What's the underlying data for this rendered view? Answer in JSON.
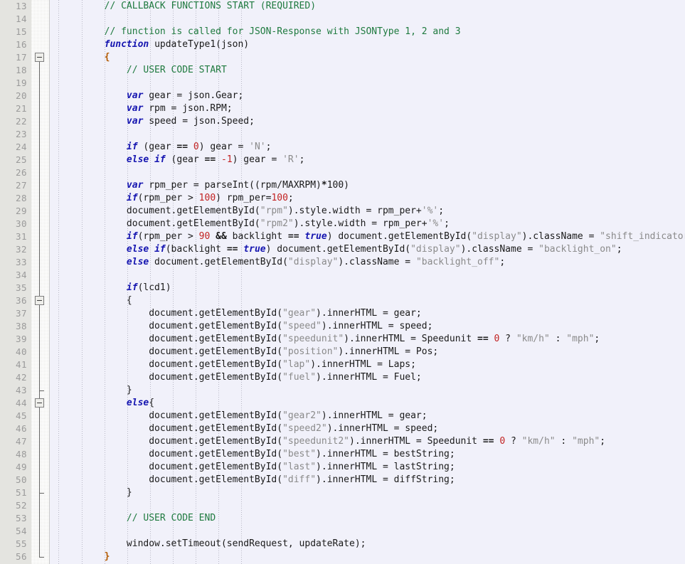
{
  "editor": {
    "kind": "code-editor",
    "language": "JavaScript",
    "theme": {
      "gutter_bg": "#e4e4e0",
      "code_bg": "#f1f1fa",
      "linenum_color": "#9a9a9a",
      "comment_color": "#1f7a3f",
      "keyword_color": "#1515b0",
      "number_color": "#c22222",
      "string_color": "#8a8a8a",
      "brace_color": "#b35a00",
      "text_color": "#1a1a1a",
      "fold_line_color": "#6b6b6b",
      "indent_guide_color": "#b9b9c6"
    },
    "first_line": 13,
    "last_line": 56,
    "line_height": 18,
    "char_width": 8.05
  },
  "fold_markers": [
    {
      "line": 17,
      "type": "open"
    },
    {
      "line": 36,
      "type": "open"
    },
    {
      "line": 43,
      "type": "end"
    },
    {
      "line": 44,
      "type": "open"
    },
    {
      "line": 51,
      "type": "end"
    },
    {
      "line": 56,
      "type": "end"
    }
  ],
  "lines": [
    {
      "n": 13,
      "tokens": [
        {
          "t": "        ",
          "c": "pln"
        },
        {
          "t": "// CALLBACK FUNCTIONS START (REQUIRED)",
          "c": "cmt"
        }
      ]
    },
    {
      "n": 14,
      "tokens": []
    },
    {
      "n": 15,
      "tokens": [
        {
          "t": "        ",
          "c": "pln"
        },
        {
          "t": "// function is called for JSON-Response with JSONType 1, 2 and 3",
          "c": "cmt"
        }
      ]
    },
    {
      "n": 16,
      "tokens": [
        {
          "t": "        ",
          "c": "pln"
        },
        {
          "t": "function",
          "c": "kw"
        },
        {
          "t": " updateType1(json)",
          "c": "pln"
        }
      ]
    },
    {
      "n": 17,
      "tokens": [
        {
          "t": "        ",
          "c": "pln"
        },
        {
          "t": "{",
          "c": "brc"
        }
      ]
    },
    {
      "n": 18,
      "tokens": [
        {
          "t": "            ",
          "c": "pln"
        },
        {
          "t": "// USER CODE START",
          "c": "cmt"
        }
      ]
    },
    {
      "n": 19,
      "tokens": []
    },
    {
      "n": 20,
      "tokens": [
        {
          "t": "            ",
          "c": "pln"
        },
        {
          "t": "var",
          "c": "kw"
        },
        {
          "t": " gear = json.Gear;",
          "c": "pln"
        }
      ]
    },
    {
      "n": 21,
      "tokens": [
        {
          "t": "            ",
          "c": "pln"
        },
        {
          "t": "var",
          "c": "kw"
        },
        {
          "t": " rpm = json.RPM;",
          "c": "pln"
        }
      ]
    },
    {
      "n": 22,
      "tokens": [
        {
          "t": "            ",
          "c": "pln"
        },
        {
          "t": "var",
          "c": "kw"
        },
        {
          "t": " speed = json.Speed;",
          "c": "pln"
        }
      ]
    },
    {
      "n": 23,
      "tokens": []
    },
    {
      "n": 24,
      "tokens": [
        {
          "t": "            ",
          "c": "pln"
        },
        {
          "t": "if",
          "c": "kw"
        },
        {
          "t": " (gear ",
          "c": "pln"
        },
        {
          "t": "==",
          "c": "op"
        },
        {
          "t": " ",
          "c": "pln"
        },
        {
          "t": "0",
          "c": "num"
        },
        {
          "t": ") gear = ",
          "c": "pln"
        },
        {
          "t": "'N'",
          "c": "str"
        },
        {
          "t": ";",
          "c": "pln"
        }
      ]
    },
    {
      "n": 25,
      "tokens": [
        {
          "t": "            ",
          "c": "pln"
        },
        {
          "t": "else",
          "c": "kw"
        },
        {
          "t": " ",
          "c": "pln"
        },
        {
          "t": "if",
          "c": "kw"
        },
        {
          "t": " (gear ",
          "c": "pln"
        },
        {
          "t": "==",
          "c": "op"
        },
        {
          "t": " ",
          "c": "pln"
        },
        {
          "t": "-1",
          "c": "num"
        },
        {
          "t": ") gear = ",
          "c": "pln"
        },
        {
          "t": "'R'",
          "c": "str"
        },
        {
          "t": ";",
          "c": "pln"
        }
      ]
    },
    {
      "n": 26,
      "tokens": []
    },
    {
      "n": 27,
      "tokens": [
        {
          "t": "            ",
          "c": "pln"
        },
        {
          "t": "var",
          "c": "kw"
        },
        {
          "t": " rpm_per = parseInt((rpm/MAXRPM)",
          "c": "pln"
        },
        {
          "t": "*",
          "c": "op"
        },
        {
          "t": "100)",
          "c": "pln"
        }
      ]
    },
    {
      "n": 28,
      "tokens": [
        {
          "t": "            ",
          "c": "pln"
        },
        {
          "t": "if",
          "c": "kw"
        },
        {
          "t": "(rpm_per > ",
          "c": "pln"
        },
        {
          "t": "100",
          "c": "num"
        },
        {
          "t": ") rpm_per=",
          "c": "pln"
        },
        {
          "t": "100",
          "c": "num"
        },
        {
          "t": ";",
          "c": "pln"
        }
      ]
    },
    {
      "n": 29,
      "tokens": [
        {
          "t": "            document.getElementById(",
          "c": "pln"
        },
        {
          "t": "\"rpm\"",
          "c": "str"
        },
        {
          "t": ").style.width = rpm_per+",
          "c": "pln"
        },
        {
          "t": "'%'",
          "c": "str"
        },
        {
          "t": ";",
          "c": "pln"
        }
      ]
    },
    {
      "n": 30,
      "tokens": [
        {
          "t": "            document.getElementById(",
          "c": "pln"
        },
        {
          "t": "\"rpm2\"",
          "c": "str"
        },
        {
          "t": ").style.width = rpm_per+",
          "c": "pln"
        },
        {
          "t": "'%'",
          "c": "str"
        },
        {
          "t": ";",
          "c": "pln"
        }
      ]
    },
    {
      "n": 31,
      "tokens": [
        {
          "t": "            ",
          "c": "pln"
        },
        {
          "t": "if",
          "c": "kw"
        },
        {
          "t": "(rpm_per > ",
          "c": "pln"
        },
        {
          "t": "90",
          "c": "num"
        },
        {
          "t": " ",
          "c": "pln"
        },
        {
          "t": "&&",
          "c": "op"
        },
        {
          "t": " backlight ",
          "c": "pln"
        },
        {
          "t": "==",
          "c": "op"
        },
        {
          "t": " ",
          "c": "pln"
        },
        {
          "t": "true",
          "c": "kw"
        },
        {
          "t": ") document.getElementById(",
          "c": "pln"
        },
        {
          "t": "\"display\"",
          "c": "str"
        },
        {
          "t": ").className = ",
          "c": "pln"
        },
        {
          "t": "\"shift_indicator\"",
          "c": "str"
        },
        {
          "t": ";",
          "c": "pln"
        }
      ]
    },
    {
      "n": 32,
      "tokens": [
        {
          "t": "            ",
          "c": "pln"
        },
        {
          "t": "else",
          "c": "kw"
        },
        {
          "t": " ",
          "c": "pln"
        },
        {
          "t": "if",
          "c": "kw"
        },
        {
          "t": "(backlight ",
          "c": "pln"
        },
        {
          "t": "==",
          "c": "op"
        },
        {
          "t": " ",
          "c": "pln"
        },
        {
          "t": "true",
          "c": "kw"
        },
        {
          "t": ") document.getElementById(",
          "c": "pln"
        },
        {
          "t": "\"display\"",
          "c": "str"
        },
        {
          "t": ").className = ",
          "c": "pln"
        },
        {
          "t": "\"backlight_on\"",
          "c": "str"
        },
        {
          "t": ";",
          "c": "pln"
        }
      ]
    },
    {
      "n": 33,
      "tokens": [
        {
          "t": "            ",
          "c": "pln"
        },
        {
          "t": "else",
          "c": "kw"
        },
        {
          "t": " document.getElementById(",
          "c": "pln"
        },
        {
          "t": "\"display\"",
          "c": "str"
        },
        {
          "t": ").className = ",
          "c": "pln"
        },
        {
          "t": "\"backlight_off\"",
          "c": "str"
        },
        {
          "t": ";",
          "c": "pln"
        }
      ]
    },
    {
      "n": 34,
      "tokens": []
    },
    {
      "n": 35,
      "tokens": [
        {
          "t": "            ",
          "c": "pln"
        },
        {
          "t": "if",
          "c": "kw"
        },
        {
          "t": "(lcd1)",
          "c": "pln"
        }
      ]
    },
    {
      "n": 36,
      "tokens": [
        {
          "t": "            {",
          "c": "pln"
        }
      ]
    },
    {
      "n": 37,
      "tokens": [
        {
          "t": "                document.getElementById(",
          "c": "pln"
        },
        {
          "t": "\"gear\"",
          "c": "str"
        },
        {
          "t": ").innerHTML = gear;",
          "c": "pln"
        }
      ]
    },
    {
      "n": 38,
      "tokens": [
        {
          "t": "                document.getElementById(",
          "c": "pln"
        },
        {
          "t": "\"speed\"",
          "c": "str"
        },
        {
          "t": ").innerHTML = speed;",
          "c": "pln"
        }
      ]
    },
    {
      "n": 39,
      "tokens": [
        {
          "t": "                document.getElementById(",
          "c": "pln"
        },
        {
          "t": "\"speedunit\"",
          "c": "str"
        },
        {
          "t": ").innerHTML = Speedunit ",
          "c": "pln"
        },
        {
          "t": "==",
          "c": "op"
        },
        {
          "t": " ",
          "c": "pln"
        },
        {
          "t": "0",
          "c": "num"
        },
        {
          "t": " ? ",
          "c": "pln"
        },
        {
          "t": "\"km/h\"",
          "c": "str"
        },
        {
          "t": " : ",
          "c": "pln"
        },
        {
          "t": "\"mph\"",
          "c": "str"
        },
        {
          "t": ";",
          "c": "pln"
        }
      ]
    },
    {
      "n": 40,
      "tokens": [
        {
          "t": "                document.getElementById(",
          "c": "pln"
        },
        {
          "t": "\"position\"",
          "c": "str"
        },
        {
          "t": ").innerHTML = Pos;",
          "c": "pln"
        }
      ]
    },
    {
      "n": 41,
      "tokens": [
        {
          "t": "                document.getElementById(",
          "c": "pln"
        },
        {
          "t": "\"lap\"",
          "c": "str"
        },
        {
          "t": ").innerHTML = Laps;",
          "c": "pln"
        }
      ]
    },
    {
      "n": 42,
      "tokens": [
        {
          "t": "                document.getElementById(",
          "c": "pln"
        },
        {
          "t": "\"fuel\"",
          "c": "str"
        },
        {
          "t": ").innerHTML = Fuel;",
          "c": "pln"
        }
      ]
    },
    {
      "n": 43,
      "tokens": [
        {
          "t": "            }",
          "c": "pln"
        }
      ]
    },
    {
      "n": 44,
      "tokens": [
        {
          "t": "            ",
          "c": "pln"
        },
        {
          "t": "else",
          "c": "kw"
        },
        {
          "t": "{",
          "c": "pln"
        }
      ]
    },
    {
      "n": 45,
      "tokens": [
        {
          "t": "                document.getElementById(",
          "c": "pln"
        },
        {
          "t": "\"gear2\"",
          "c": "str"
        },
        {
          "t": ").innerHTML = gear;",
          "c": "pln"
        }
      ]
    },
    {
      "n": 46,
      "tokens": [
        {
          "t": "                document.getElementById(",
          "c": "pln"
        },
        {
          "t": "\"speed2\"",
          "c": "str"
        },
        {
          "t": ").innerHTML = speed;",
          "c": "pln"
        }
      ]
    },
    {
      "n": 47,
      "tokens": [
        {
          "t": "                document.getElementById(",
          "c": "pln"
        },
        {
          "t": "\"speedunit2\"",
          "c": "str"
        },
        {
          "t": ").innerHTML = Speedunit ",
          "c": "pln"
        },
        {
          "t": "==",
          "c": "op"
        },
        {
          "t": " ",
          "c": "pln"
        },
        {
          "t": "0",
          "c": "num"
        },
        {
          "t": " ? ",
          "c": "pln"
        },
        {
          "t": "\"km/h\"",
          "c": "str"
        },
        {
          "t": " : ",
          "c": "pln"
        },
        {
          "t": "\"mph\"",
          "c": "str"
        },
        {
          "t": ";",
          "c": "pln"
        }
      ]
    },
    {
      "n": 48,
      "tokens": [
        {
          "t": "                document.getElementById(",
          "c": "pln"
        },
        {
          "t": "\"best\"",
          "c": "str"
        },
        {
          "t": ").innerHTML = bestString;",
          "c": "pln"
        }
      ]
    },
    {
      "n": 49,
      "tokens": [
        {
          "t": "                document.getElementById(",
          "c": "pln"
        },
        {
          "t": "\"last\"",
          "c": "str"
        },
        {
          "t": ").innerHTML = lastString;",
          "c": "pln"
        }
      ]
    },
    {
      "n": 50,
      "tokens": [
        {
          "t": "                document.getElementById(",
          "c": "pln"
        },
        {
          "t": "\"diff\"",
          "c": "str"
        },
        {
          "t": ").innerHTML = diffString;",
          "c": "pln"
        }
      ]
    },
    {
      "n": 51,
      "tokens": [
        {
          "t": "            }",
          "c": "pln"
        }
      ]
    },
    {
      "n": 52,
      "tokens": []
    },
    {
      "n": 53,
      "tokens": [
        {
          "t": "            ",
          "c": "pln"
        },
        {
          "t": "// USER CODE END",
          "c": "cmt"
        }
      ]
    },
    {
      "n": 54,
      "tokens": []
    },
    {
      "n": 55,
      "tokens": [
        {
          "t": "            window.setTimeout(sendRequest, updateRate);",
          "c": "pln"
        }
      ]
    },
    {
      "n": 56,
      "tokens": [
        {
          "t": "        ",
          "c": "pln"
        },
        {
          "t": "}",
          "c": "brc"
        }
      ]
    }
  ],
  "indent_guides_x": [
    12,
    45,
    77,
    109,
    141,
    173,
    205,
    237,
    269
  ]
}
